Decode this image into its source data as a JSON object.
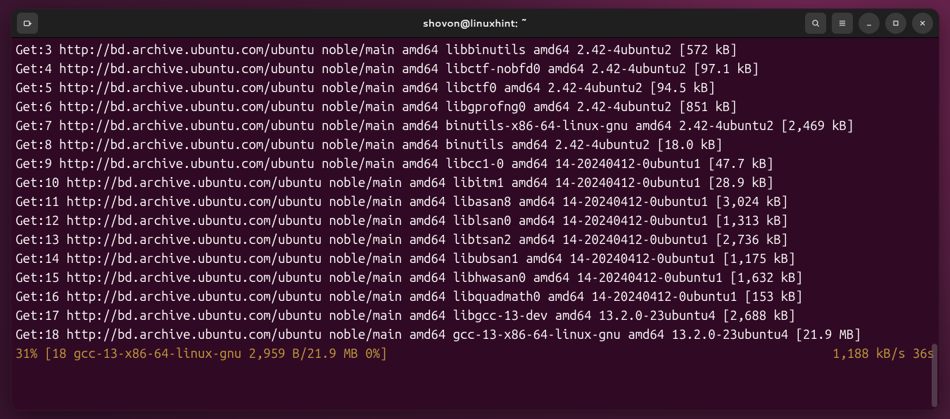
{
  "window": {
    "title": "shovon@linuxhint: ~"
  },
  "lines": [
    "Get:3 http://bd.archive.ubuntu.com/ubuntu noble/main amd64 libbinutils amd64 2.42-4ubuntu2 [572 kB]",
    "Get:4 http://bd.archive.ubuntu.com/ubuntu noble/main amd64 libctf-nobfd0 amd64 2.42-4ubuntu2 [97.1 kB]",
    "Get:5 http://bd.archive.ubuntu.com/ubuntu noble/main amd64 libctf0 amd64 2.42-4ubuntu2 [94.5 kB]",
    "Get:6 http://bd.archive.ubuntu.com/ubuntu noble/main amd64 libgprofng0 amd64 2.42-4ubuntu2 [851 kB]",
    "Get:7 http://bd.archive.ubuntu.com/ubuntu noble/main amd64 binutils-x86-64-linux-gnu amd64 2.42-4ubuntu2 [2,469 kB]",
    "Get:8 http://bd.archive.ubuntu.com/ubuntu noble/main amd64 binutils amd64 2.42-4ubuntu2 [18.0 kB]",
    "Get:9 http://bd.archive.ubuntu.com/ubuntu noble/main amd64 libcc1-0 amd64 14-20240412-0ubuntu1 [47.7 kB]",
    "Get:10 http://bd.archive.ubuntu.com/ubuntu noble/main amd64 libitm1 amd64 14-20240412-0ubuntu1 [28.9 kB]",
    "Get:11 http://bd.archive.ubuntu.com/ubuntu noble/main amd64 libasan8 amd64 14-20240412-0ubuntu1 [3,024 kB]",
    "Get:12 http://bd.archive.ubuntu.com/ubuntu noble/main amd64 liblsan0 amd64 14-20240412-0ubuntu1 [1,313 kB]",
    "Get:13 http://bd.archive.ubuntu.com/ubuntu noble/main amd64 libtsan2 amd64 14-20240412-0ubuntu1 [2,736 kB]",
    "Get:14 http://bd.archive.ubuntu.com/ubuntu noble/main amd64 libubsan1 amd64 14-20240412-0ubuntu1 [1,175 kB]",
    "Get:15 http://bd.archive.ubuntu.com/ubuntu noble/main amd64 libhwasan0 amd64 14-20240412-0ubuntu1 [1,632 kB]",
    "Get:16 http://bd.archive.ubuntu.com/ubuntu noble/main amd64 libquadmath0 amd64 14-20240412-0ubuntu1 [153 kB]",
    "Get:17 http://bd.archive.ubuntu.com/ubuntu noble/main amd64 libgcc-13-dev amd64 13.2.0-23ubuntu4 [2,688 kB]",
    "Get:18 http://bd.archive.ubuntu.com/ubuntu noble/main amd64 gcc-13-x86-64-linux-gnu amd64 13.2.0-23ubuntu4 [21.9 MB]"
  ],
  "status": {
    "left": "31% [18 gcc-13-x86-64-linux-gnu 2,959 B/21.9 MB 0%]",
    "right": "1,188 kB/s 36s"
  }
}
